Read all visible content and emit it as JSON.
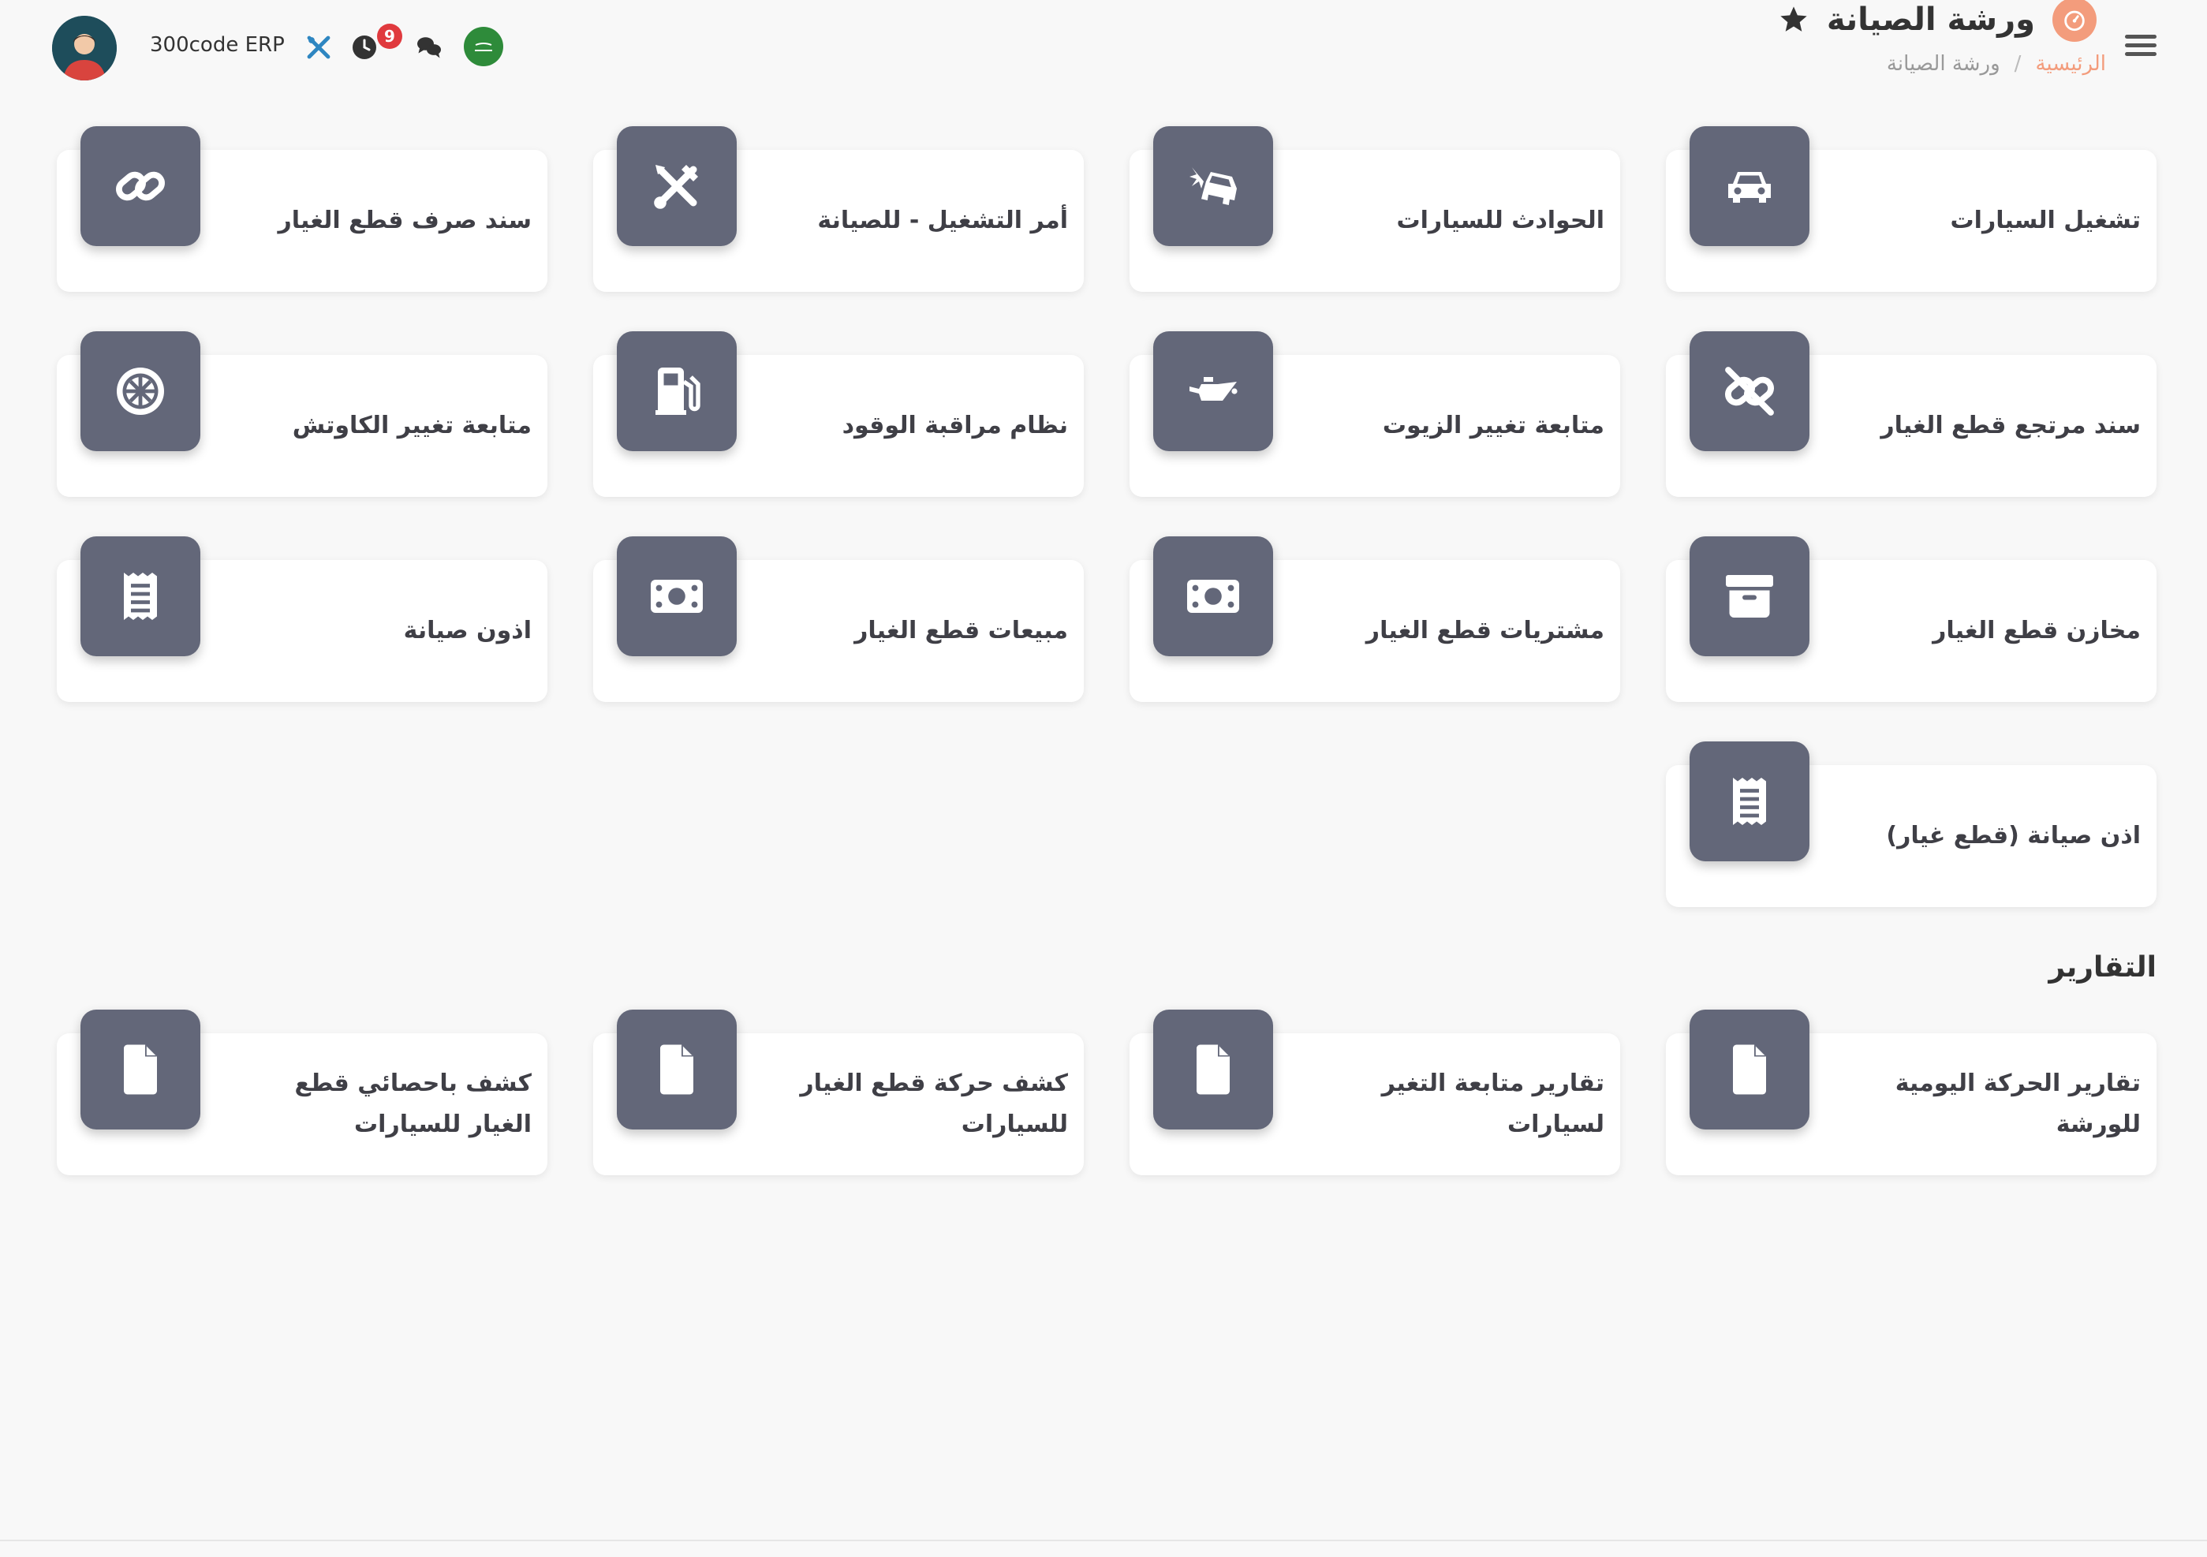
{
  "header": {
    "page_title": "ورشة الصيانة",
    "breadcrumb": {
      "home": "الرئيسية",
      "separator": "/",
      "current": "ورشة الصيانة"
    },
    "app_name": "300code ERP",
    "notification_count": "9"
  },
  "cards": [
    {
      "label": "تشغيل السيارات",
      "icon": "car-icon"
    },
    {
      "label": "الحوادث للسيارات",
      "icon": "car-crash-icon"
    },
    {
      "label": "أمر التشغيل - للصيانة",
      "icon": "tools-icon"
    },
    {
      "label": "سند صرف قطع الغيار",
      "icon": "link-icon"
    },
    {
      "label": "سند مرتجع قطع الغيار",
      "icon": "unlink-icon"
    },
    {
      "label": "متابعة تغيير الزيوت",
      "icon": "oil-can-icon"
    },
    {
      "label": "نظام مراقبة الوقود",
      "icon": "gas-pump-icon"
    },
    {
      "label": "متابعة تغيير الكاوتش",
      "icon": "tire-icon"
    },
    {
      "label": "مخازن قطع الغيار",
      "icon": "archive-icon"
    },
    {
      "label": "مشتريات قطع الغيار",
      "icon": "money-bill-icon"
    },
    {
      "label": "مبيعات قطع الغيار",
      "icon": "money-bill-icon"
    },
    {
      "label": "اذون صيانة",
      "icon": "receipt-icon"
    },
    {
      "label": "اذن صيانة (قطع غيار)",
      "icon": "receipt-icon"
    }
  ],
  "reports_section": {
    "title": "التقارير",
    "cards": [
      {
        "label": "تقارير الحركة اليومية للورشة",
        "icon": "file-icon"
      },
      {
        "label": "تقارير متابعة التغير لسيارات",
        "icon": "file-icon"
      },
      {
        "label": "كشف حركة قطع الغيار للسيارات",
        "icon": "file-icon"
      },
      {
        "label": "كشف باحصائي قطع الغيار للسيارات",
        "icon": "file-icon"
      }
    ]
  },
  "colors": {
    "accent": "#f39c7c",
    "tile": "#636779",
    "badge": "#e03a3e",
    "tools_icon": "#2e86c1",
    "flag": "#2e8b3a",
    "background": "#f8f8f8"
  }
}
